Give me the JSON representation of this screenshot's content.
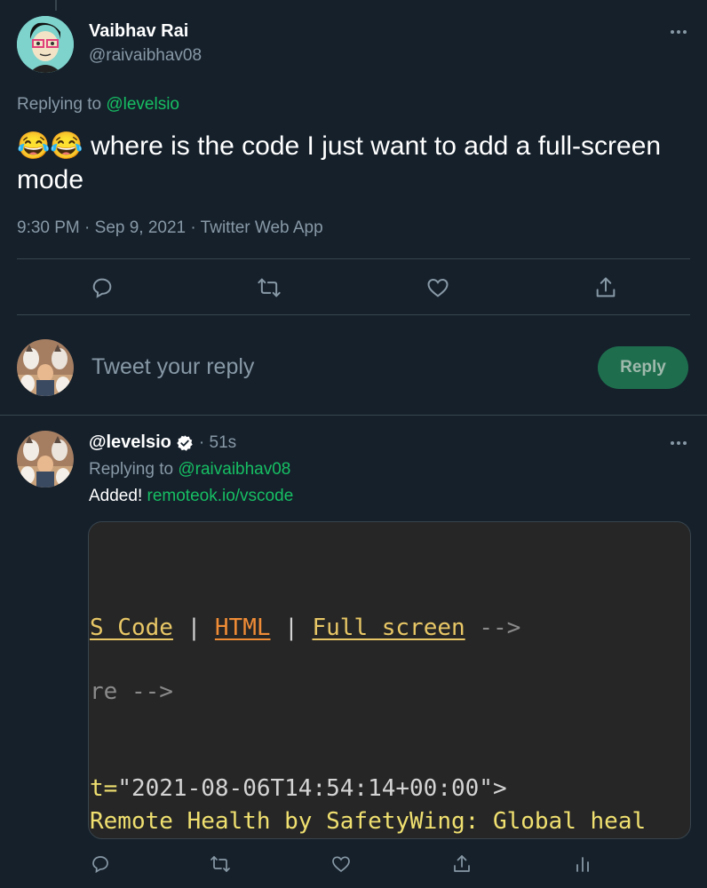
{
  "tweet1": {
    "name": "Vaibhav Rai",
    "handle": "@raivaibhav08",
    "replying_prefix": "Replying to",
    "replying_to": "@levelsio",
    "emoji": "😂😂",
    "text": "where is the code I just want to add a full-screen mode",
    "timestamp": "9:30 PM · Sep 9, 2021 · Twitter Web App"
  },
  "composer": {
    "placeholder": "Tweet your reply",
    "reply_label": "Reply"
  },
  "tweet2": {
    "handle": "@levelsio",
    "time": "· 51s",
    "replying_prefix": "Replying to",
    "replying_to": "@raivaibhav08",
    "text_prefix": "Added!",
    "link": "remoteok.io/vscode",
    "code": {
      "line1_a": "S Code",
      "line1_sep1": " | ",
      "line1_b": "HTML",
      "line1_sep2": " | ",
      "line1_c": "Full screen",
      "line1_end": " -->",
      "line2": "re -->",
      "line3_a": "t=",
      "line3_b": "\"2021-08-06T14:54:14+00:00\"",
      "line3_c": ">",
      "line4": "Remote Health by SafetyWing: Global heal"
    }
  },
  "icons": [
    "reply-icon",
    "retweet-icon",
    "like-icon",
    "share-icon",
    "analytics-icon",
    "more-icon",
    "verified-icon"
  ],
  "colors": {
    "background": "#15202b",
    "accent": "#17bf63",
    "muted": "#8899a6",
    "divider": "#38444d"
  }
}
